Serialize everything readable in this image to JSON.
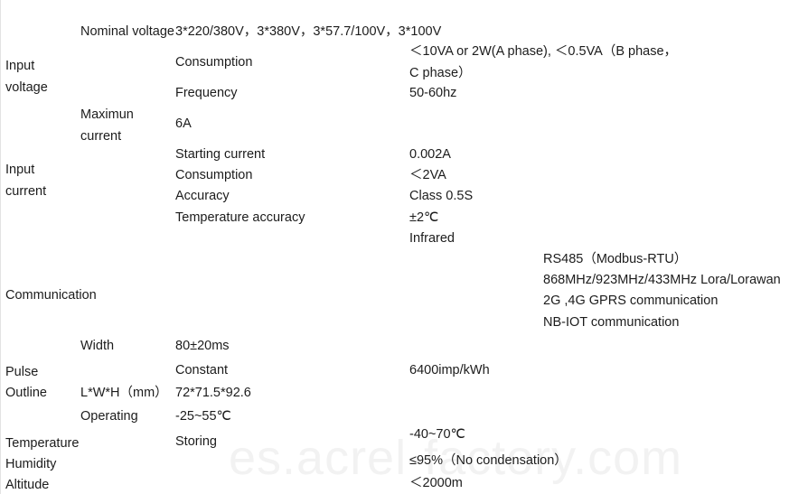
{
  "watermark": "es.acrel-factory.com",
  "rows": [
    {
      "group": "",
      "sub": "",
      "param": "Nominal voltage",
      "value": "3*220/380V，3*380V，3*57.7/100V，3*100V"
    },
    {
      "group": "Input\nvoltage",
      "sub": "",
      "param": "Consumption",
      "value": "＜10VA or 2W(A phase), ＜0.5VA（B phase，C phase）"
    },
    {
      "group": "",
      "sub": "",
      "param": "Frequency",
      "value": "50-60hz"
    },
    {
      "group": "",
      "sub": "Maximun\ncurrent",
      "param": "",
      "value": "6A"
    },
    {
      "group": "",
      "sub": "",
      "param": "Starting current",
      "value": "0.002A"
    },
    {
      "group": "Input\ncurrent",
      "sub": "",
      "param": "Consumption",
      "value": "＜2VA"
    },
    {
      "group": "",
      "sub": "",
      "param": "Accuracy",
      "value": "Class 0.5S"
    },
    {
      "group": "",
      "sub": "",
      "param": "Temperature accuracy",
      "value": "±2℃"
    },
    {
      "group": "",
      "sub": "",
      "param": "",
      "value": "Infrared"
    },
    {
      "group": "Communication",
      "sub": "",
      "param": "",
      "value": ""
    },
    {
      "group": "",
      "sub": "Width",
      "param": "80±20ms",
      "value": ""
    },
    {
      "group": "Pulse",
      "sub": "",
      "param": "Constant",
      "value": "6400imp/kWh"
    },
    {
      "group": "Outline",
      "sub": "L*W*H（mm）",
      "param": "72*71.5*92.6",
      "value": ""
    },
    {
      "group": "",
      "sub": "Operating",
      "param": "-25~55℃",
      "value": ""
    },
    {
      "group": "Temperature",
      "sub": "",
      "param": "Storing",
      "value": "-40~70℃"
    },
    {
      "group": "Humidity",
      "sub": "",
      "param": "",
      "value": "≤95%（No condensation）"
    },
    {
      "group": "Altitude",
      "sub": "",
      "param": "",
      "value": "＜2000m"
    }
  ],
  "labels": {
    "nominal_voltage": "Nominal voltage",
    "nominal_voltage_value": "3*220/380V，3*380V，3*57.7/100V，3*100V",
    "input_voltage": "Input\nvoltage",
    "consumption_1": "Consumption",
    "consumption_1_value": "＜10VA or 2W(A phase), ＜0.5VA（B phase，C phase）",
    "frequency": "Frequency",
    "frequency_value": "50-60hz",
    "maximum_current": "Maximun\ncurrent",
    "maximum_current_value": "6A",
    "starting_current": "Starting current",
    "starting_current_value": "0.002A",
    "input_current": "Input\ncurrent",
    "consumption_2": "Consumption",
    "consumption_2_value": "＜2VA",
    "accuracy": "Accuracy",
    "accuracy_value": "Class 0.5S",
    "temperature_accuracy": "Temperature accuracy",
    "temperature_accuracy_value": "±2℃",
    "infrared_value": "Infrared",
    "communication": "Communication",
    "comm_line_1": "RS485（Modbus-RTU）",
    "comm_line_2": "868MHz/923MHz/433MHz Lora/Lorawan",
    "comm_line_3": "2G ,4G GPRS communication",
    "comm_line_4": "NB-IOT communication",
    "pulse_width": "Width",
    "pulse_width_value": "80±20ms",
    "pulse": "Pulse",
    "pulse_constant": "Constant",
    "pulse_constant_value": "6400imp/kWh",
    "outline": "Outline",
    "outline_dims": "L*W*H（mm）",
    "outline_dims_value": "72*71.5*92.6",
    "operating": "Operating",
    "operating_value": "-25~55℃",
    "temperature": "Temperature",
    "storing": "Storing",
    "storing_value": "-40~70℃",
    "humidity": "Humidity",
    "humidity_value": "≤95%（No condensation）",
    "altitude": "Altitude",
    "altitude_value": "＜2000m"
  }
}
